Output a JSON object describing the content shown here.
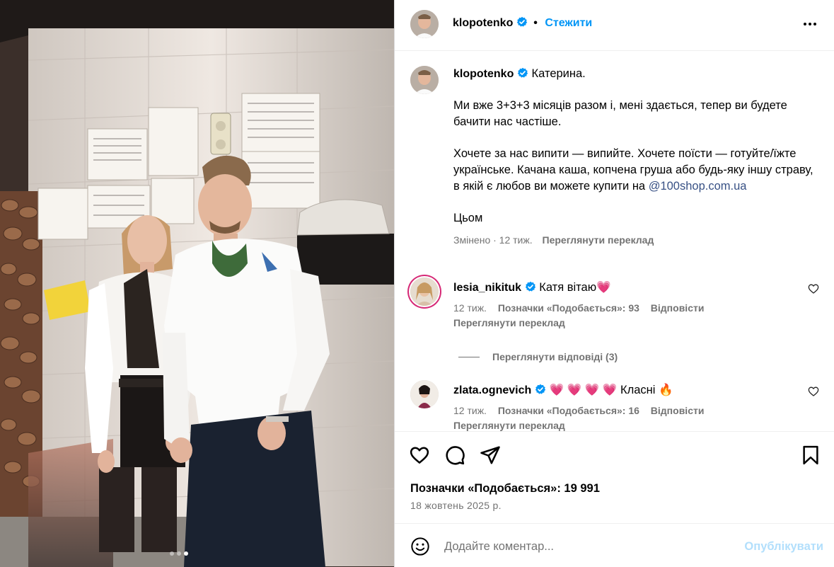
{
  "colors": {
    "accent": "#0095f6",
    "link": "#385185",
    "secondary_text": "#737373",
    "verified": "#0095f6",
    "heart": "#ff3040"
  },
  "icons": {
    "verified": "verified-badge-icon",
    "more": "more-options-icon",
    "like": "heart-icon",
    "comment": "comment-bubble-icon",
    "share": "paper-plane-icon",
    "save": "bookmark-icon",
    "emoji": "smiley-icon"
  },
  "carousel": {
    "total": 3,
    "active": 3
  },
  "header": {
    "username": "klopotenko",
    "follow_label": "Стежити"
  },
  "caption": {
    "username": "klopotenko",
    "first_line": "Катерина.",
    "p1": "Ми вже 3+3+3 місяців разом і, мені здається, тепер ви будете бачити нас частіше.",
    "p2": "Хочете за нас випити — випийте. Хочете поїсти — готуйте/їжте українське. Качана каша, копчена груша або будь-яку іншу страву, в якій є любов ви можете купити на",
    "p2_link": "@100shop.com.ua",
    "p3": "Цьом",
    "edited_time": "Змінено · 12 тиж.",
    "translate_label": "Переглянути переклад"
  },
  "comments": [
    {
      "username": "lesia_nikituk",
      "text": "Катя вітаю💗",
      "time": "12 тиж.",
      "likes": "Позначки «Подобається»: 93",
      "reply_label": "Відповісти",
      "translate_label": "Переглянути переклад",
      "view_replies": "Переглянути відповіді (3)"
    },
    {
      "username": "zlata.ognevich",
      "text": "💗 💗 💗 💗 Класні 🔥",
      "time": "12 тиж.",
      "likes": "Позначки «Подобається»: 16",
      "reply_label": "Відповісти",
      "translate_label": "Переглянути переклад"
    }
  ],
  "post": {
    "likes": "Позначки «Подобається»: 19 991",
    "date": "18 жовтень 2025 р."
  },
  "add_comment": {
    "placeholder": "Додайте коментар...",
    "post_label": "Опублікувати"
  }
}
